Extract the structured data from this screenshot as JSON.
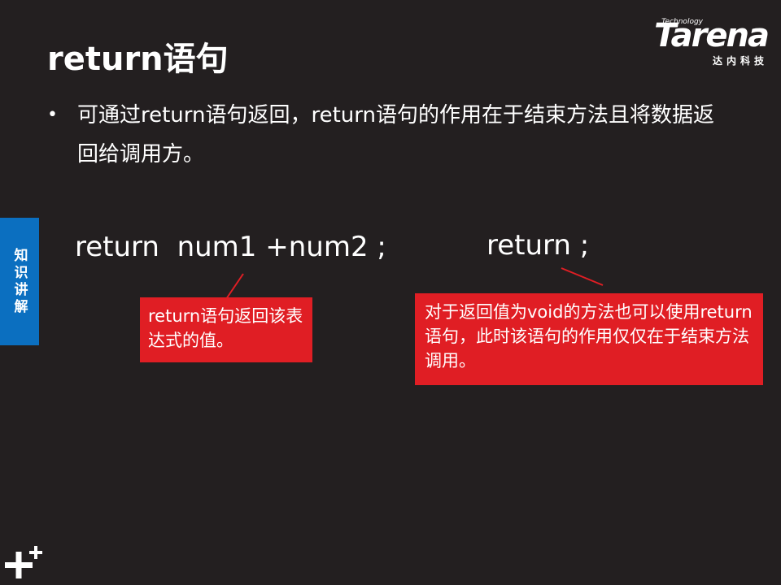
{
  "slide": {
    "title": "return语句",
    "bullet": "可通过return语句返回，return语句的作用在于结束方法且将数据返回给调用方。"
  },
  "logo": {
    "technology": "Technology",
    "wordmark": "Tarena",
    "chinese": "达内科技"
  },
  "side_tab": {
    "label": "知识讲解"
  },
  "code_examples": [
    {
      "text": "return  num1 +num2 ;"
    },
    {
      "text": "return ;"
    }
  ],
  "callouts": [
    {
      "text": "return语句返回该表达式的值。"
    },
    {
      "text": "对于返回值为void的方法也可以使用return语句，此时该语句的作用仅仅在于结束方法调用。"
    }
  ],
  "colors": {
    "background": "#231f20",
    "callout": "#e01e24",
    "side_tab": "#0b6fc0",
    "text": "#ffffff"
  }
}
